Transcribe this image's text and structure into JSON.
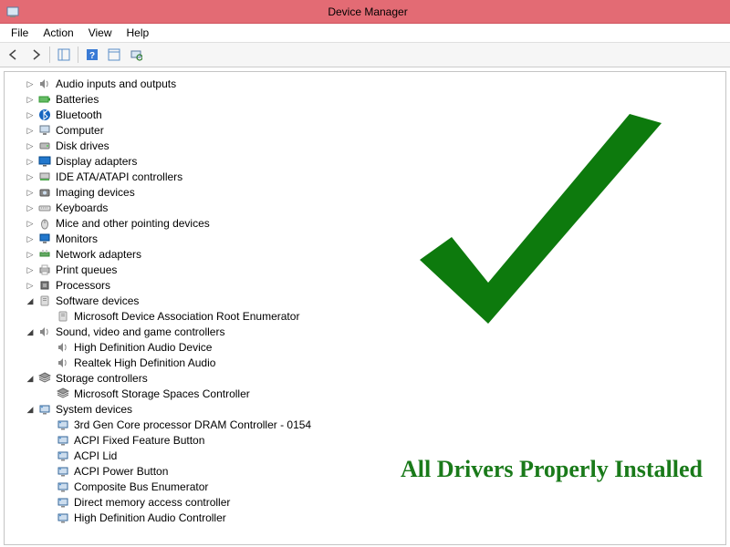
{
  "window": {
    "title": "Device Manager"
  },
  "menus": {
    "file": "File",
    "action": "Action",
    "view": "View",
    "help": "Help"
  },
  "overlay": {
    "message": "All Drivers Properly Installed"
  },
  "tree": [
    {
      "label": "Audio inputs and outputs",
      "icon": "speaker",
      "state": "closed",
      "indent": 1
    },
    {
      "label": "Batteries",
      "icon": "battery",
      "state": "closed",
      "indent": 1
    },
    {
      "label": "Bluetooth",
      "icon": "bluetooth",
      "state": "closed",
      "indent": 1
    },
    {
      "label": "Computer",
      "icon": "computer",
      "state": "closed",
      "indent": 1
    },
    {
      "label": "Disk drives",
      "icon": "disk",
      "state": "closed",
      "indent": 1
    },
    {
      "label": "Display adapters",
      "icon": "display",
      "state": "closed",
      "indent": 1
    },
    {
      "label": "IDE ATA/ATAPI controllers",
      "icon": "ide",
      "state": "closed",
      "indent": 1
    },
    {
      "label": "Imaging devices",
      "icon": "camera",
      "state": "closed",
      "indent": 1
    },
    {
      "label": "Keyboards",
      "icon": "keyboard",
      "state": "closed",
      "indent": 1
    },
    {
      "label": "Mice and other pointing devices",
      "icon": "mouse",
      "state": "closed",
      "indent": 1
    },
    {
      "label": "Monitors",
      "icon": "monitor",
      "state": "closed",
      "indent": 1
    },
    {
      "label": "Network adapters",
      "icon": "network",
      "state": "closed",
      "indent": 1
    },
    {
      "label": "Print queues",
      "icon": "printer",
      "state": "closed",
      "indent": 1
    },
    {
      "label": "Processors",
      "icon": "cpu",
      "state": "closed",
      "indent": 1
    },
    {
      "label": "Software devices",
      "icon": "software",
      "state": "open",
      "indent": 1
    },
    {
      "label": "Microsoft Device Association Root Enumerator",
      "icon": "software",
      "state": "leaf",
      "indent": 2
    },
    {
      "label": "Sound, video and game controllers",
      "icon": "speaker",
      "state": "open",
      "indent": 1
    },
    {
      "label": "High Definition Audio Device",
      "icon": "speaker",
      "state": "leaf",
      "indent": 2
    },
    {
      "label": "Realtek High Definition Audio",
      "icon": "speaker",
      "state": "leaf",
      "indent": 2
    },
    {
      "label": "Storage controllers",
      "icon": "storage",
      "state": "open",
      "indent": 1
    },
    {
      "label": "Microsoft Storage Spaces Controller",
      "icon": "storage",
      "state": "leaf",
      "indent": 2
    },
    {
      "label": "System devices",
      "icon": "system",
      "state": "open",
      "indent": 1
    },
    {
      "label": "3rd Gen Core processor DRAM Controller - 0154",
      "icon": "system",
      "state": "leaf",
      "indent": 2
    },
    {
      "label": "ACPI Fixed Feature Button",
      "icon": "system",
      "state": "leaf",
      "indent": 2
    },
    {
      "label": "ACPI Lid",
      "icon": "system",
      "state": "leaf",
      "indent": 2
    },
    {
      "label": "ACPI Power Button",
      "icon": "system",
      "state": "leaf",
      "indent": 2
    },
    {
      "label": "Composite Bus Enumerator",
      "icon": "system",
      "state": "leaf",
      "indent": 2
    },
    {
      "label": "Direct memory access controller",
      "icon": "system",
      "state": "leaf",
      "indent": 2
    },
    {
      "label": "High Definition Audio Controller",
      "icon": "system",
      "state": "leaf",
      "indent": 2
    }
  ]
}
